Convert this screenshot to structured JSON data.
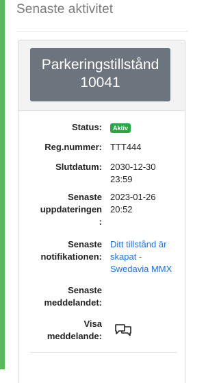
{
  "section": {
    "heading": "Senaste aktivitet"
  },
  "permit": {
    "title_line1": "Parkeringstillstånd",
    "title_line2": "10041"
  },
  "details": {
    "status_label": "Status:",
    "status_value": "Aktiv",
    "reg_label": "Reg.nummer:",
    "reg_value": "TTT444",
    "end_label": "Slutdatum:",
    "end_date": "2030-12-30",
    "end_time": "23:59",
    "updated_label_1": "Senaste",
    "updated_label_2": "uppdateringen",
    "updated_label_3": ":",
    "updated_date": "2023-01-26",
    "updated_time": "20:52",
    "notif_label_1": "Senaste",
    "notif_label_2": "notifikationen:",
    "notif_link_1": "Ditt tillstånd är",
    "notif_link_2": "skapat -",
    "notif_link_3": "Swedavia MMX",
    "message_label_1": "Senaste",
    "message_label_2": "meddelandet:",
    "show_label_1": "Visa",
    "show_label_2": "meddelande:"
  },
  "colors": {
    "accent_bar": "#5cb85c",
    "title_box": "#6c757d",
    "badge_active": "#28a745",
    "link": "#1a73e8"
  },
  "icons": {
    "show_message": "message-bubbles-icon"
  }
}
